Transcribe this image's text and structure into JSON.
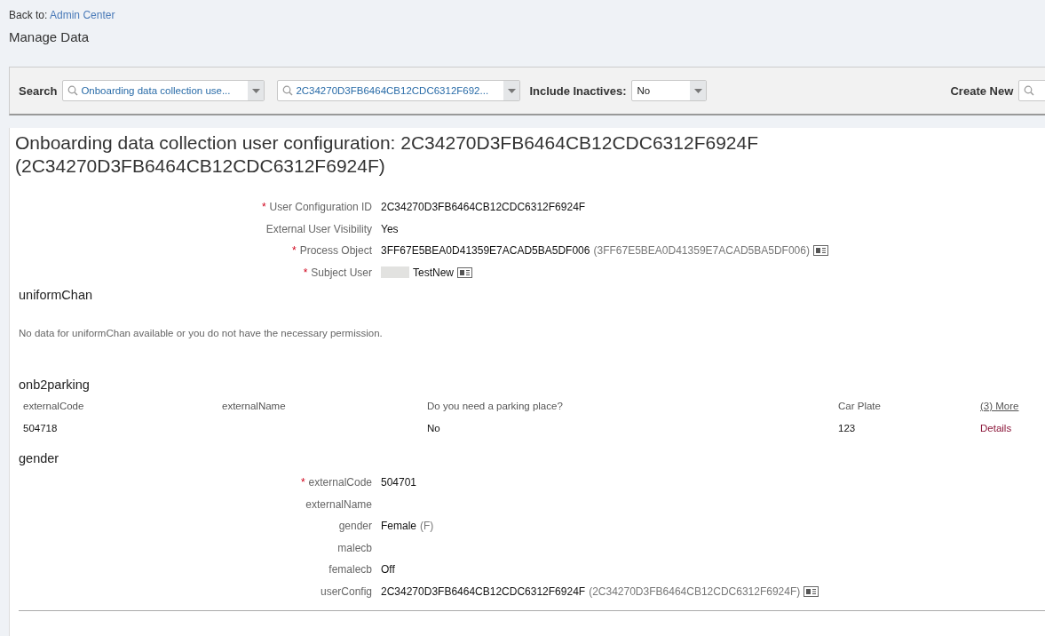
{
  "back": {
    "prefix": "Back to:",
    "link": "Admin Center"
  },
  "page_title": "Manage Data",
  "toolbar": {
    "search_label": "Search",
    "object_type": "Onboarding data collection use...",
    "object_id": "2C34270D3FB6464CB12CDC6312F692...",
    "inactives_label": "Include Inactives:",
    "inactives_value": "No",
    "create_label": "Create New"
  },
  "record_title": "Onboarding data collection user configuration: 2C34270D3FB6464CB12CDC6312F6924F (2C34270D3FB6464CB12CDC6312F6924F)",
  "header_fields": [
    {
      "required_mark": "*",
      "label": "User Configuration ID",
      "value": "2C34270D3FB6464CB12CDC6312F6924F",
      "details_icon": false,
      "redacted": false
    },
    {
      "label": "External User Visibility",
      "value": "Yes",
      "details_icon": false,
      "redacted": false
    },
    {
      "required_mark": "*",
      "label": "Process Object",
      "value": "3FF67E5BEA0D41359E7ACAD5BA5DF006",
      "secondary": "(3FF67E5BEA0D41359E7ACAD5BA5DF006)",
      "details_icon": true,
      "redacted": false
    },
    {
      "required_mark": "*",
      "label": "Subject User",
      "value": "TestNew",
      "details_icon": true,
      "redacted": true
    }
  ],
  "uniform": {
    "title": "uniformChan",
    "message": "No data for uniformChan available or you do not have the necessary permission."
  },
  "parking": {
    "title": "onb2parking",
    "columns": [
      "externalCode",
      "externalName",
      "Do you need a parking place?",
      "Car Plate"
    ],
    "more_link": "(3) More",
    "rows": [
      {
        "cells": [
          "504718",
          null,
          "No",
          "123"
        ],
        "link": "Details"
      }
    ]
  },
  "gender": {
    "title": "gender",
    "fields": [
      {
        "required_mark": "*",
        "label": "externalCode",
        "value": "504701",
        "details_icon": false,
        "redacted": false
      },
      {
        "label": "externalName",
        "details_icon": false,
        "redacted": false
      },
      {
        "label": "gender",
        "value": "Female",
        "secondary": "(F)",
        "details_icon": false,
        "redacted": false
      },
      {
        "label": "malecb",
        "details_icon": false,
        "redacted": false
      },
      {
        "label": "femalecb",
        "value": "Off",
        "details_icon": false,
        "redacted": false
      },
      {
        "label": "userConfig",
        "value": "2C34270D3FB6464CB12CDC6312F6924F",
        "secondary": "(2C34270D3FB6464CB12CDC6312F6924F)",
        "details_icon": true,
        "redacted": false
      }
    ]
  }
}
